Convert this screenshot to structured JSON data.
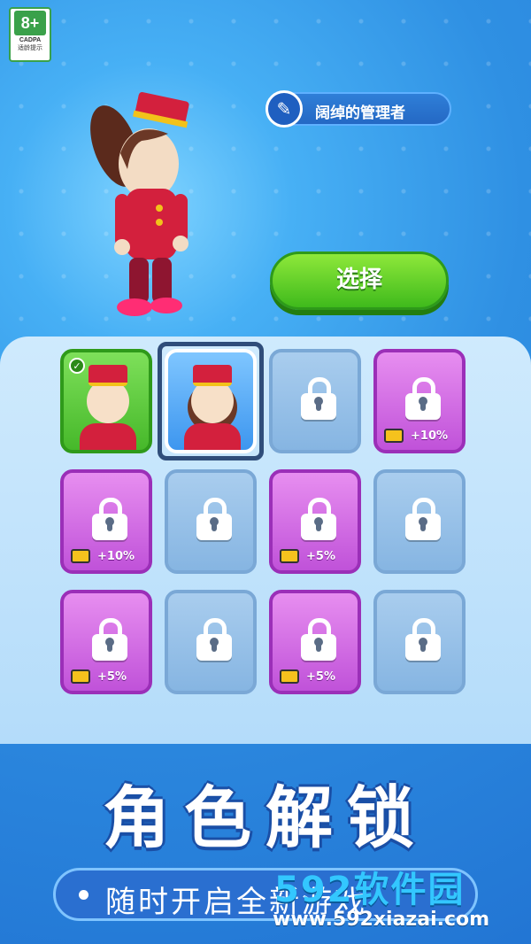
{
  "age_badge": {
    "rating": "8+",
    "org": "CADPA",
    "tip": "适龄提示"
  },
  "character": {
    "title": "阔绰的管理者",
    "select_label": "选择"
  },
  "cards": [
    {
      "type": "selected",
      "locked": false,
      "bonus": ""
    },
    {
      "type": "current",
      "locked": false,
      "bonus": ""
    },
    {
      "type": "grey",
      "locked": true,
      "bonus": ""
    },
    {
      "type": "purple",
      "locked": true,
      "bonus": "+10%"
    },
    {
      "type": "purple",
      "locked": true,
      "bonus": "+10%"
    },
    {
      "type": "grey",
      "locked": true,
      "bonus": ""
    },
    {
      "type": "purple",
      "locked": true,
      "bonus": "+5%"
    },
    {
      "type": "grey",
      "locked": true,
      "bonus": ""
    },
    {
      "type": "purple",
      "locked": true,
      "bonus": "+5%"
    },
    {
      "type": "grey",
      "locked": true,
      "bonus": ""
    },
    {
      "type": "purple",
      "locked": true,
      "bonus": "+5%"
    },
    {
      "type": "grey",
      "locked": true,
      "bonus": ""
    }
  ],
  "promo": {
    "headline": "角色解锁",
    "subtitle": "随时开启全新游戏"
  },
  "watermark": {
    "brand": "592软件园",
    "url": "www.592xiazai.com"
  }
}
